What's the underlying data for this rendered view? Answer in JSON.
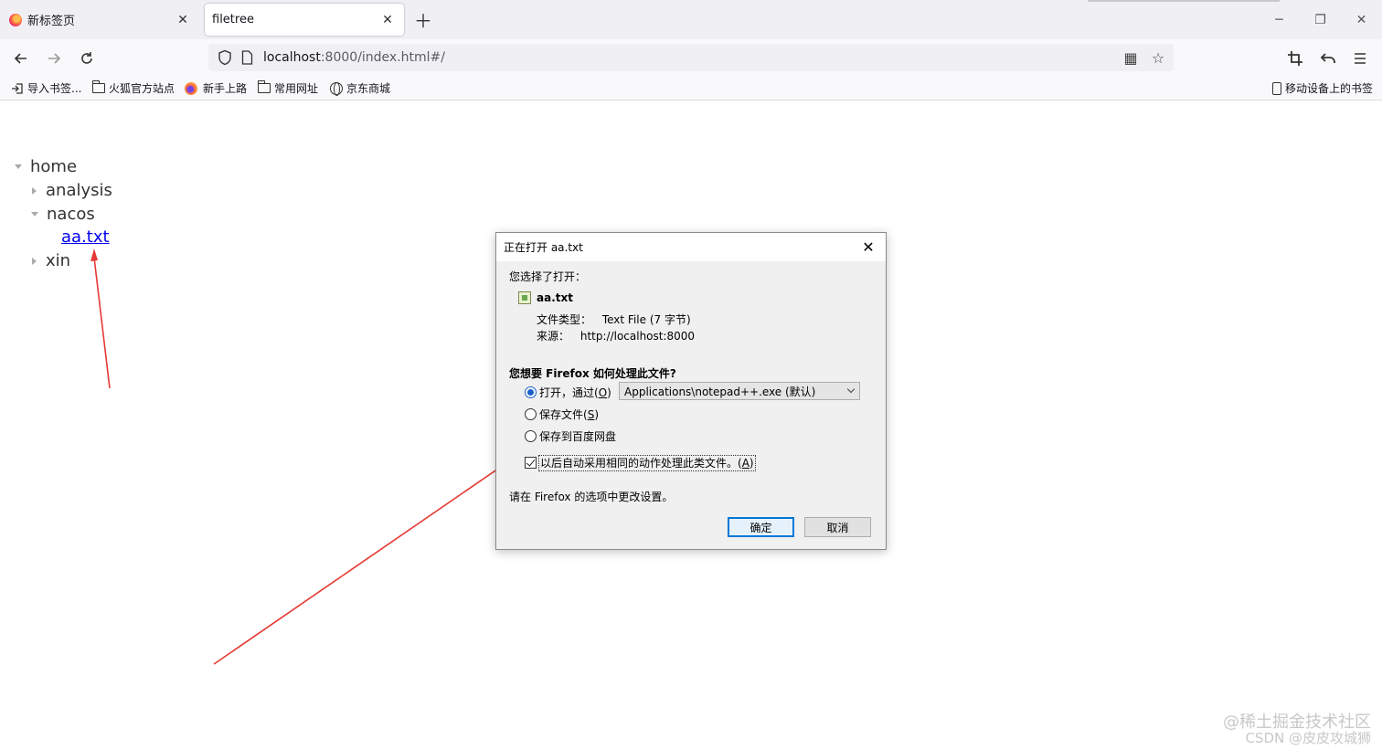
{
  "tabs": [
    {
      "title": "新标签页",
      "active": false
    },
    {
      "title": "filetree",
      "active": true
    }
  ],
  "nav": {
    "url_host": "localhost",
    "url_rest": ":8000/index.html#/"
  },
  "bookmarks": {
    "items": [
      {
        "label": "导入书签...",
        "icon": "import-icon"
      },
      {
        "label": "火狐官方站点",
        "icon": "folder-icon"
      },
      {
        "label": "新手上路",
        "icon": "firefox-icon"
      },
      {
        "label": "常用网址",
        "icon": "folder-icon"
      },
      {
        "label": "京东商城",
        "icon": "globe-icon"
      }
    ],
    "mobile": "移动设备上的书签"
  },
  "tree": {
    "root": "home",
    "children": [
      "analysis",
      "nacos",
      "xin"
    ],
    "nacos_file": "aa.txt"
  },
  "dialog": {
    "title": "正在打开 aa.txt",
    "chosen_label": "您选择了打开：",
    "filename": "aa.txt",
    "type_label": "文件类型：",
    "type_value": "Text File (7 字节)",
    "source_label": "来源：",
    "source_value": "http://localhost:8000",
    "question": "您想要 Firefox 如何处理此文件?",
    "open_with_label": "打开，通过(",
    "open_with_key": "O",
    "open_with_end": ")",
    "open_with_app": "Applications\\notepad++.exe (默认)",
    "save_file_label": "保存文件(",
    "save_file_key": "S",
    "save_file_end": ")",
    "save_baidu_label": "保存到百度网盘",
    "auto_label": "以后自动采用相同的动作处理此类文件。(",
    "auto_key": "A",
    "auto_end": ")",
    "settings_note": "请在 Firefox 的选项中更改设置。",
    "ok": "确定",
    "cancel": "取消"
  },
  "watermark": {
    "line1": "@稀土掘金技术社区",
    "line2": "CSDN @皮皮攻城狮"
  },
  "colors": {
    "arrow": "#e53935",
    "link": "#0000ee",
    "accent": "#0078d7"
  }
}
